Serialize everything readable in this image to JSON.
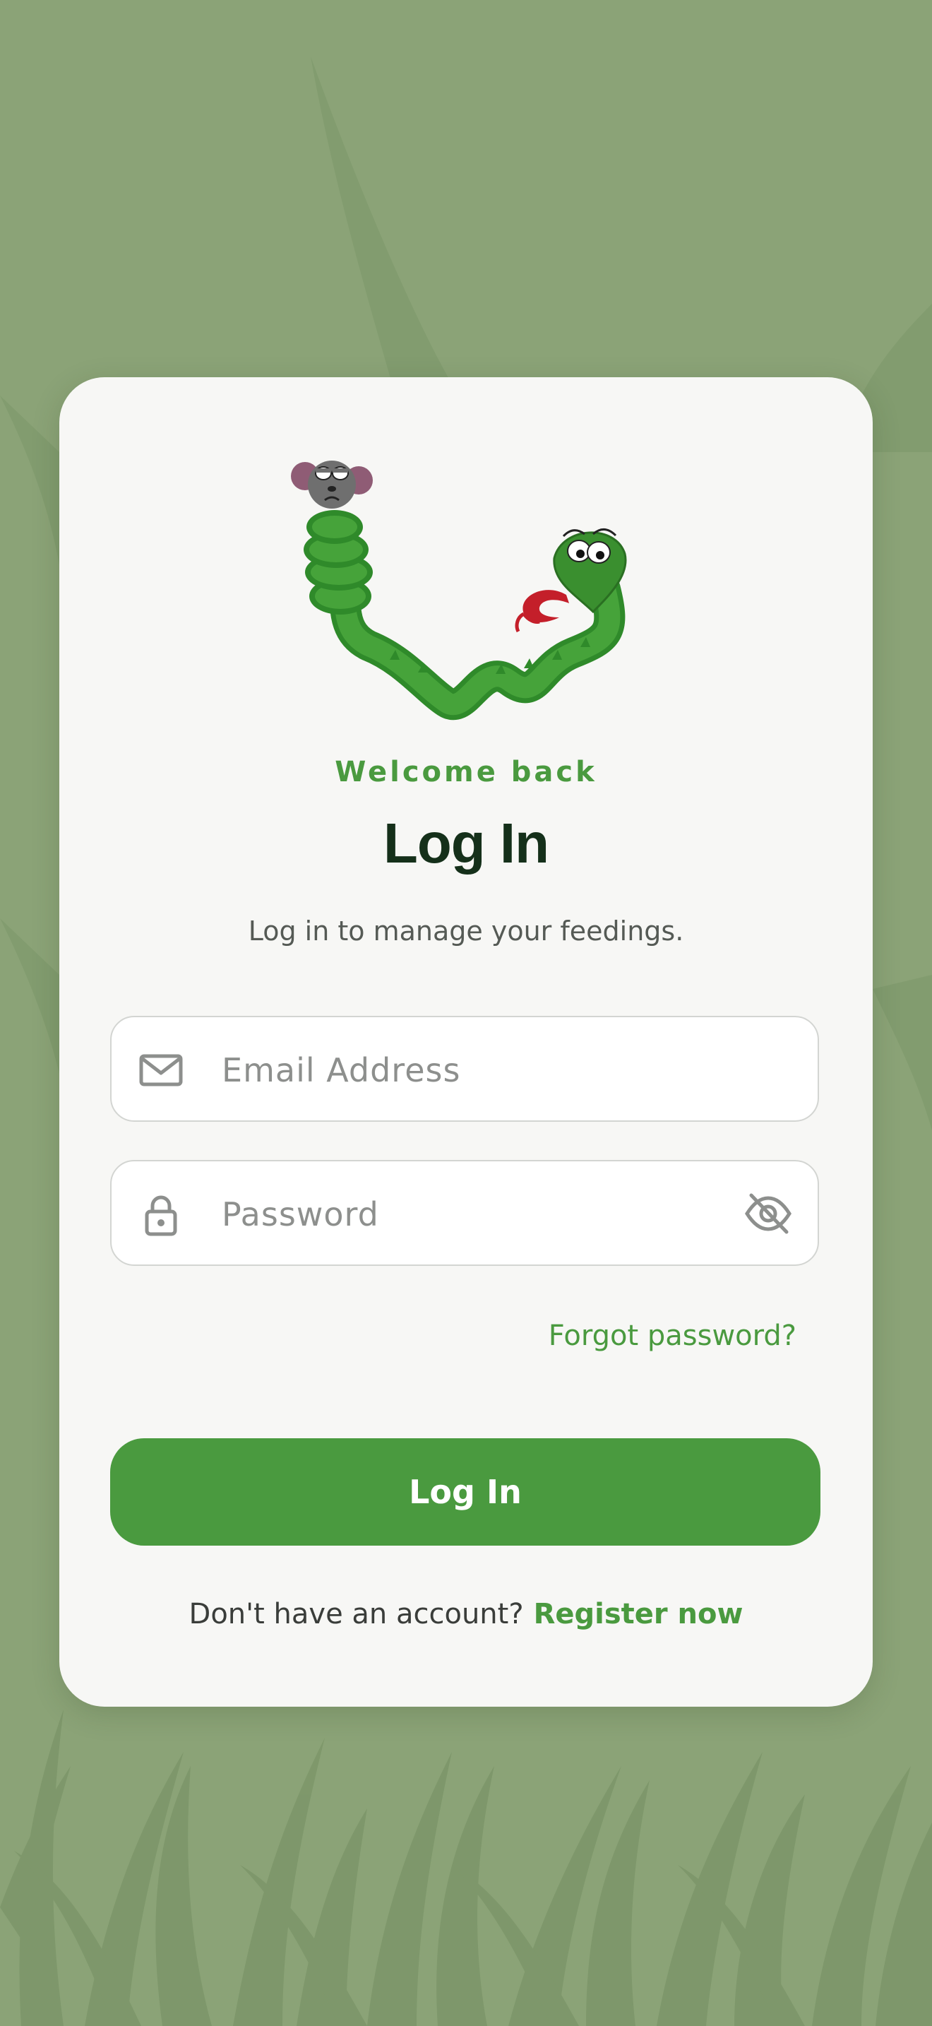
{
  "login": {
    "eyebrow": "Welcome back",
    "title": "Log In",
    "subtitle": "Log in to manage your feedings.",
    "email_placeholder": "Email Address",
    "password_placeholder": "Password",
    "forgot_password": "Forgot password?",
    "submit_label": "Log In",
    "no_account_text": "Don't have an account?",
    "register_link": "Register now"
  },
  "icons": {
    "email": "mail-icon",
    "password": "lock-icon",
    "toggle_visibility": "eye-off-icon"
  },
  "colors": {
    "background": "#8ba377",
    "card": "#f7f7f5",
    "accent": "#4a9a3f",
    "title": "#15301a",
    "placeholder": "#8d8f8d"
  }
}
